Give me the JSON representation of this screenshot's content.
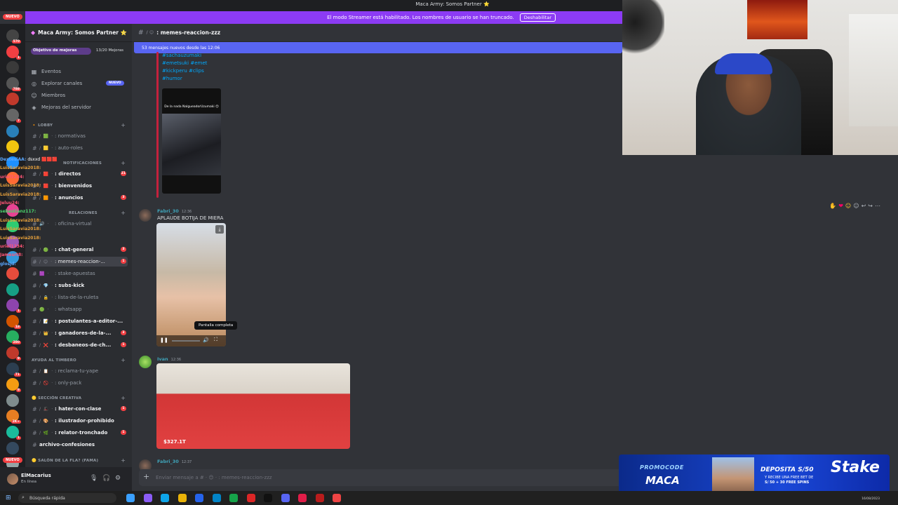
{
  "window": {
    "title": "Maca Army: Somos Partner ⭐"
  },
  "streamer_banner": {
    "text": "El modo Streamer está habilitado. Los nombres de usuario se han truncado.",
    "button": "Deshabilitar"
  },
  "rail": {
    "nuevo": "NUEVO",
    "badges": [
      "570",
      "1",
      "",
      "788",
      "",
      "7",
      "",
      "",
      "",
      "",
      "",
      "",
      "",
      "",
      "",
      "",
      "",
      "1",
      "18",
      "280",
      "9",
      "71",
      "8",
      "",
      "2K+",
      "1",
      "",
      "4"
    ],
    "nuevo_bottom": "NUEVO"
  },
  "stream_chat": [
    {
      "user": "DextesiAA",
      "msg": "dsxxd 🟥🟥🟥",
      "cls": "b"
    },
    {
      "user": "LuisSaravia2018",
      "msg": "",
      "cls": ""
    },
    {
      "user": "uriel1234",
      "msg": "",
      "cls": "r"
    },
    {
      "user": "LuisSaravia2018",
      "msg": "",
      "cls": ""
    },
    {
      "user": "LuisSaravia2018",
      "msg": "",
      "cls": ""
    },
    {
      "user": "Jeluu24",
      "msg": "",
      "cls": "r"
    },
    {
      "user": "sebastianz117",
      "msg": "",
      "cls": "g"
    },
    {
      "user": "",
      "msg": "",
      "cls": ""
    },
    {
      "user": "LuisSaravia2018",
      "msg": "",
      "cls": ""
    },
    {
      "user": "LuisSaravia2018",
      "msg": "",
      "cls": ""
    },
    {
      "user": "LuisSaravia2018",
      "msg": "",
      "cls": ""
    },
    {
      "user": "uriel1234",
      "msg": "",
      "cls": "r"
    },
    {
      "user": "Jamesrt8",
      "msg": "",
      "cls": "r"
    },
    {
      "user": "glosjd",
      "msg": "",
      "cls": "b"
    }
  ],
  "sidebar": {
    "server_name": "Maca Army: Somos Partner ⭐",
    "boost": {
      "label": "Objetivo de mejoras",
      "count": "13/20 Mejoras",
      "progress": 0.65
    },
    "menu": [
      {
        "icon": "▦",
        "label": "Eventos",
        "badge": ""
      },
      {
        "icon": "◎",
        "label": "Explorar canales",
        "badge": "NUEVO"
      },
      {
        "icon": "☺",
        "label": "Miembros",
        "badge": ""
      },
      {
        "icon": "◈",
        "label": "Mejoras del servidor",
        "badge": ""
      }
    ],
    "categories": {
      "lobby": "🔸 LOBBY",
      "notificaciones": "NOTIFICACIONES",
      "relaciones": "RELACIONES",
      "ayuda": "AYUDA AL TIMBERO",
      "creativa": "🟡 SECCIÓN CREATIVA",
      "salon": "🟡 SALÓN DE LA FLA? (FAMA)"
    },
    "channels": [
      {
        "emo": "/ 🟩 ·",
        "name": ": normativas",
        "unread": false,
        "active": false,
        "badge": ""
      },
      {
        "emo": "/ 🟨 ·",
        "name": ": auto-roles",
        "unread": false,
        "active": false,
        "badge": ""
      },
      {
        "emo": "/ 🟥 ·",
        "name": ": directos",
        "unread": true,
        "active": false,
        "badge": "21"
      },
      {
        "emo": "/ 🟥 ·",
        "name": ": bienvenidos",
        "unread": true,
        "active": false,
        "badge": ""
      },
      {
        "emo": "/ 🟧 ·",
        "name": ": anuncios",
        "unread": true,
        "active": false,
        "badge": "3"
      },
      {
        "emo": "🔊 ·",
        "name": ": oficina-virtual",
        "unread": false,
        "active": false,
        "badge": ""
      },
      {
        "emo": "/ 🟢 ·",
        "name": ": chat-general",
        "unread": true,
        "active": false,
        "badge": "3"
      },
      {
        "emo": "/ 😊 ·",
        "name": ": memes-reaccion-...",
        "unread": false,
        "active": true,
        "badge": "1"
      },
      {
        "emo": "🟪 ·",
        "name": ": stake-apuestas",
        "unread": false,
        "active": false,
        "badge": ""
      },
      {
        "emo": "/ 💎 ·",
        "name": ": subs-kick",
        "unread": true,
        "active": false,
        "badge": ""
      },
      {
        "emo": "/ 🔒 ·",
        "name": ": lista-de-la-ruleta",
        "unread": false,
        "active": false,
        "badge": ""
      },
      {
        "emo": "🟢 ·",
        "name": ": whatsapp",
        "unread": false,
        "active": false,
        "badge": ""
      },
      {
        "emo": "/ 📝 ·",
        "name": ": postulantes-a-editor-...",
        "unread": true,
        "active": false,
        "badge": ""
      },
      {
        "emo": "/ 👑 ·",
        "name": ": ganadores-de-la-...",
        "unread": true,
        "active": false,
        "badge": "3"
      },
      {
        "emo": "/ ❌ ·",
        "name": ": desbaneos-de-ch...",
        "unread": true,
        "active": false,
        "badge": "1"
      },
      {
        "emo": "/ 📋 ·",
        "name": ": reclama-tu-yape",
        "unread": false,
        "active": false,
        "badge": ""
      },
      {
        "emo": "/ 🚫 ·",
        "name": ": only-pack",
        "unread": false,
        "active": false,
        "badge": ""
      },
      {
        "emo": "/ 🎩 ·",
        "name": ": hater-con-clase",
        "unread": true,
        "active": false,
        "badge": "1"
      },
      {
        "emo": "/ 🎨 ·",
        "name": ": ilustrador-prohibido",
        "unread": true,
        "active": false,
        "badge": ""
      },
      {
        "emo": "/ 🌿 ·",
        "name": ": relator-tronchado",
        "unread": true,
        "active": false,
        "badge": "1"
      },
      {
        "emo": "",
        "name": "archivo-confesiones",
        "unread": true,
        "active": false,
        "badge": ""
      }
    ]
  },
  "user": {
    "name": "ElMacarius",
    "status": "En línea"
  },
  "channel": {
    "name": ": memes-reaccion-zzz",
    "new_messages": "53 mensajes nuevos desde las 12:06",
    "tags": [
      "#sachauzumaki",
      "#emetsuki #emet",
      "#kickperu #clips",
      "#humor"
    ],
    "embed_caption": "De la nada NalgueadorUzumaki 😊",
    "messages": [
      {
        "author": "Fabri_30",
        "time": "12:36",
        "text": "APLAUDE BOTIJA DE MIERA"
      },
      {
        "author": "Ivan",
        "time": "12:36",
        "text": ""
      },
      {
        "author": "Fabri_30",
        "time": "12:37",
        "text": ""
      }
    ],
    "tooltip": "Pantalla completa",
    "video2_money": "$327.1T",
    "composer_placeholder": "Enviar mensaje a # · 😊 · : memes-reaccion-zzz"
  },
  "promo": {
    "line1": "PROMOCODE",
    "line2": "MACA",
    "deposit": "DEPOSITA S/50",
    "sub1": "Y RECIBE UNA FREE BET DE",
    "sub2": "S/ 50 + 30 FREE SPINS",
    "brand": "Stake"
  },
  "taskbar": {
    "search": "Búsqueda rápida",
    "date": "16/08/2023"
  }
}
